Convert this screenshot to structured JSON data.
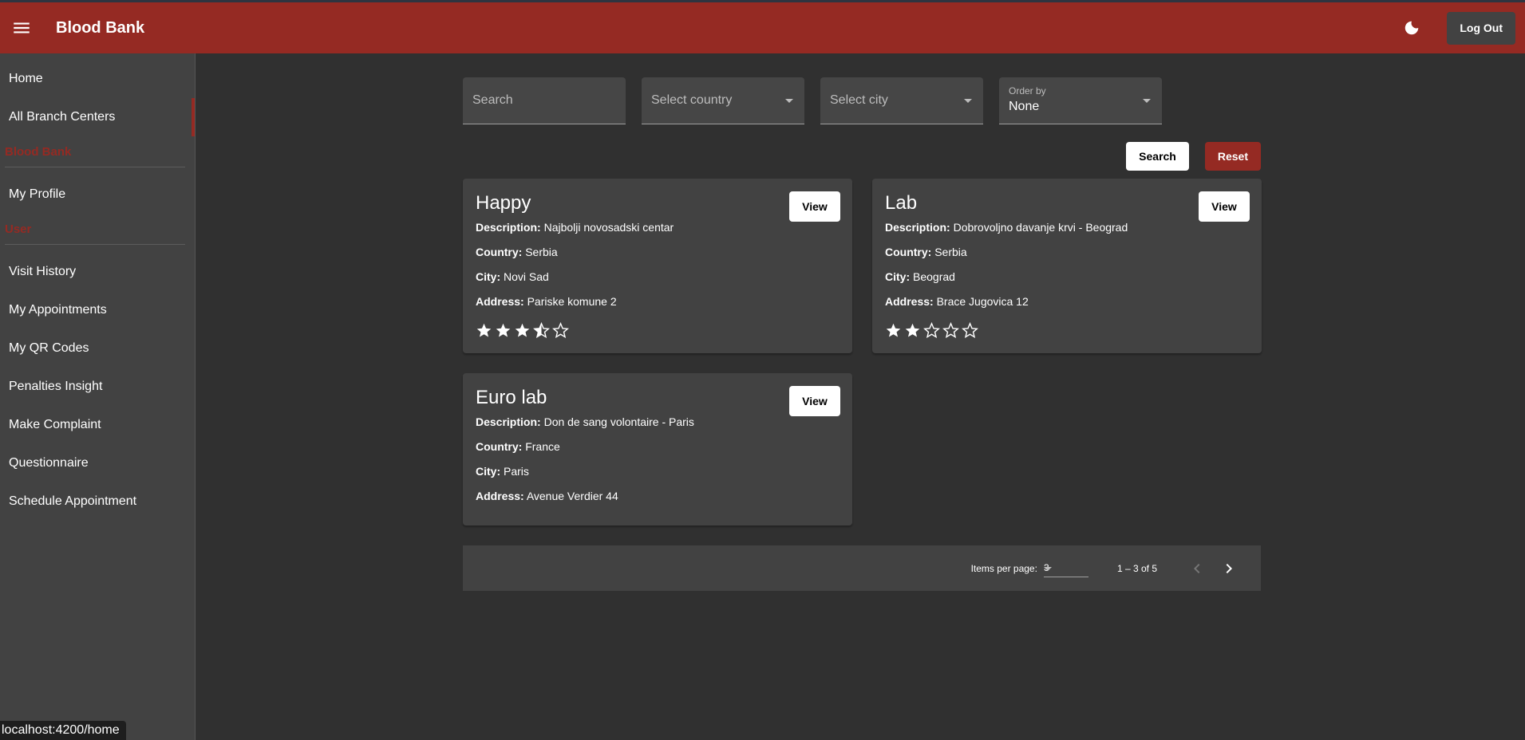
{
  "header": {
    "title": "Blood Bank",
    "logout_label": "Log Out"
  },
  "sidebar": {
    "items_top": [
      {
        "label": "Home"
      },
      {
        "label": "All Branch Centers",
        "active": true
      }
    ],
    "section_blood_bank": "Blood Bank",
    "items_blood_bank": [
      {
        "label": "My Profile"
      }
    ],
    "section_user": "User",
    "items_user": [
      {
        "label": "Visit History"
      },
      {
        "label": "My Appointments"
      },
      {
        "label": "My QR Codes"
      },
      {
        "label": "Penalties Insight"
      },
      {
        "label": "Make Complaint"
      },
      {
        "label": "Questionnaire"
      },
      {
        "label": "Schedule Appointment"
      }
    ]
  },
  "status_url": "localhost:4200/home",
  "filters": {
    "search_placeholder": "Search",
    "country_placeholder": "Select country",
    "city_placeholder": "Select city",
    "order_label": "Order by",
    "order_value": "None"
  },
  "actions": {
    "search_label": "Search",
    "reset_label": "Reset"
  },
  "labels": {
    "description": "Description:",
    "country": "Country:",
    "city": "City:",
    "address": "Address:",
    "view": "View"
  },
  "cards": [
    {
      "title": "Happy",
      "description": "Najbolji novosadski centar",
      "country": "Serbia",
      "city": "Novi Sad",
      "address": "Pariske komune 2",
      "rating": 3.5,
      "show_rating": true
    },
    {
      "title": "Lab",
      "description": "Dobrovoljno davanje krvi - Beograd",
      "country": "Serbia",
      "city": "Beograd",
      "address": "Brace Jugovica 12",
      "rating": 2,
      "show_rating": true
    },
    {
      "title": "Euro lab",
      "description": "Don de sang volontaire - Paris",
      "country": "France",
      "city": "Paris",
      "address": "Avenue Verdier 44",
      "rating": 0,
      "show_rating": false
    }
  ],
  "paginator": {
    "items_per_page_label": "Items per page:",
    "items_per_page_value": "3",
    "range_label": "1 – 3 of 5"
  },
  "colors": {
    "accent": "#952a23",
    "background": "#303030",
    "surface": "#424242"
  }
}
